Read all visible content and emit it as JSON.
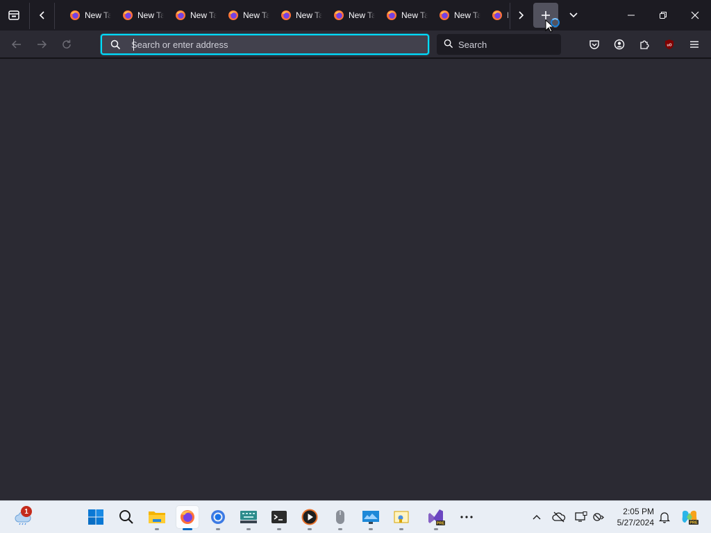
{
  "tabs": {
    "labels": [
      "New Tab",
      "New Tab",
      "New Tab",
      "New Tab",
      "New Tab",
      "New Tab",
      "New Tab",
      "New Tab",
      "New Tab"
    ]
  },
  "navbar": {
    "url_placeholder": "Search or enter address",
    "search_placeholder": "Search"
  },
  "toolbar_icons": [
    "pocket-icon",
    "account-icon",
    "extensions-icon",
    "ublock-origin-icon",
    "hamburger-menu-icon"
  ],
  "taskbar": {
    "weather_badge": "1",
    "apps": [
      "start",
      "search",
      "file-explorer",
      "firefox",
      "chrome",
      "keyboard-app",
      "terminal",
      "media-player",
      "mouse-app",
      "monitor-app",
      "paint-app",
      "visual-studio-preview",
      "more"
    ]
  },
  "clock": {
    "time": "2:05 PM",
    "date": "5/27/2024"
  },
  "colors": {
    "accent": "#00ddff",
    "tabbar_bg": "#1c1b22",
    "toolbar_bg": "#2b2a33",
    "taskbar_bg": "#e9eef5"
  }
}
